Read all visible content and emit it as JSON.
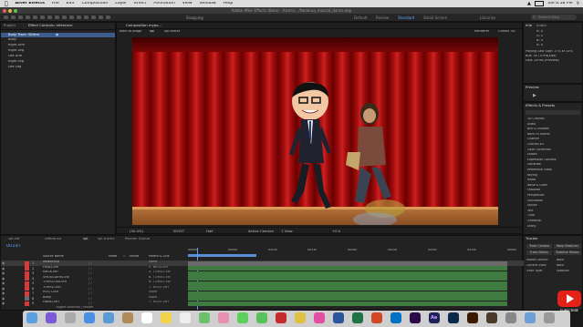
{
  "menubar": {
    "app_name": "After Effects",
    "items": [
      "File",
      "Edit",
      "Composition",
      "Layer",
      "Effect",
      "Animation",
      "View",
      "Window",
      "Help"
    ],
    "clock": "Tue 6:58 PM"
  },
  "titlebar": {
    "text": "Adobe After Effects (Beta) - /Users/.../Nodoruo_mascot_dance.aep"
  },
  "toolbar": {
    "snapping_label": "Snapping",
    "workspaces": [
      "Default",
      "Review",
      "Standard",
      "Small Screen",
      "Libraries"
    ],
    "active_workspace": "Standard",
    "search_placeholder": "Search Help"
  },
  "project_panel": {
    "tab": "Project",
    "comp_label": "Effect Controls: reference",
    "items": [
      "Body Track: Sliders",
      "Body",
      "Right Arm",
      "Right Leg",
      "Left Arm",
      "Right Leg",
      "Left Leg"
    ],
    "selected_index": 0
  },
  "viewer": {
    "tab": "Composition mypo...",
    "breadcrumbs": [
      "walk-to-stage",
      "spl",
      "spl-tracks"
    ],
    "renderer_label": "Renderer",
    "renderer_value": "Classic 3D",
    "zoom": "(50.4%)",
    "timecode": "00197",
    "quality": "Half",
    "camera": "Active Camera",
    "views": "1 View",
    "offset": "+0.0"
  },
  "info_panel": {
    "tabs": [
      "Info",
      "Audio"
    ],
    "r": "R: 0",
    "g": "G: 0",
    "b": "B: 0",
    "a": "A: 0",
    "line1": "Playing Last Sign: 17% of 33%",
    "line2": "Bus: 30 / 0 ms(Edit)",
    "line3": "Last: 28 ms (Preview)"
  },
  "preview_panel": {
    "title": "Preview"
  },
  "effects_panel": {
    "title": "Effects & Presets",
    "search_placeholder": "",
    "items": [
      "3D Channel",
      "Audio",
      "Blur & Sharpen",
      "Boris FX Mocha",
      "Channel",
      "CINEMA 4D",
      "Color Correction",
      "Distort",
      "Expression Controls",
      "Generate",
      "Immersive Video",
      "Keying",
      "Matte",
      "Noise & Grain",
      "Obsolete",
      "Perspective",
      "Simulation",
      "Stylize",
      "Text",
      "Time",
      "Transition",
      "Utility"
    ]
  },
  "tracker_panel": {
    "title": "Tracker",
    "buttons": [
      "Track Camera",
      "Warp Stabilizer",
      "Track Motion",
      "Stabilize Motion"
    ],
    "motion_source_label": "Motion Source:",
    "motion_source_value": "None",
    "current_track_label": "Current Track:",
    "current_track_value": "None",
    "track_type_label": "Track Type:",
    "track_type_value": "Stabilize"
  },
  "timeline": {
    "tabs": [
      "spl-vid",
      "reference",
      "spl",
      "spl-tracks"
    ],
    "active_tab": "spl",
    "render_queue": "Render Queue",
    "timecode": "00197",
    "column_headers": [
      "Source Name",
      "Mode",
      "T",
      "TrkMat",
      "Parent & Link"
    ],
    "ruler": [
      "00000",
      "00050",
      "00100",
      "00150",
      "00200",
      "00250",
      "00300",
      "00350",
      "00400"
    ],
    "footer": "Toggle Switches / Modes",
    "layers": [
      {
        "num": "1",
        "name": "Reference",
        "color": "#d63a3a",
        "parent": "None"
      },
      {
        "num": "2",
        "name": "HEAD-ctrl",
        "color": "#d63a3a",
        "parent": "5. NECK-ctrl"
      },
      {
        "num": "3",
        "name": "NECK-ctrl",
        "color": "#d63a3a",
        "parent": "4. TORSO-ctrl"
      },
      {
        "num": "4",
        "name": "SHOULDERS-ctrl",
        "color": "#d63a3a",
        "parent": "6. TORSO-ctrl"
      },
      {
        "num": "5",
        "name": "TORSO-rot-ctrl",
        "color": "#d63a3a",
        "parent": "6. TORSO-ctrl"
      },
      {
        "num": "6",
        "name": "TORSO-ctrl",
        "color": "#d63a3a",
        "parent": "7. ROOT-ctrl"
      },
      {
        "num": "7",
        "name": "ROOT-ctrl",
        "color": "#d63a3a",
        "parent": "None"
      },
      {
        "num": "8",
        "name": "Body",
        "color": "#6a6a6a",
        "parent": "None"
      },
      {
        "num": "9",
        "name": "HAND-ctrl",
        "color": "#d63a3a",
        "parent": "7. ROOT-ctrl"
      }
    ]
  },
  "dock": {
    "apps": [
      "Finder",
      "Siri",
      "Launchpad",
      "Safari",
      "Mail",
      "Contacts",
      "Calendar",
      "Notes",
      "Reminders",
      "Maps",
      "Photos",
      "Messages",
      "FaceTime",
      "Acrobat",
      "Chrome",
      "iTunes",
      "Word",
      "Excel",
      "PowerPoint",
      "Outlook",
      "Premiere",
      "Ae",
      "Ps",
      "Ai",
      "Bridge",
      "Preferences",
      "Folder",
      "Trash"
    ],
    "ae_label": "Ae"
  },
  "youtube": {
    "label": "SUBSCRIBE",
    "color": "#e62117"
  },
  "colors": {
    "accent": "#5aa1ff",
    "layer_bar": "#3f7a40",
    "selected_row": "#3d5b8c",
    "curtain": "#a00d0d"
  }
}
